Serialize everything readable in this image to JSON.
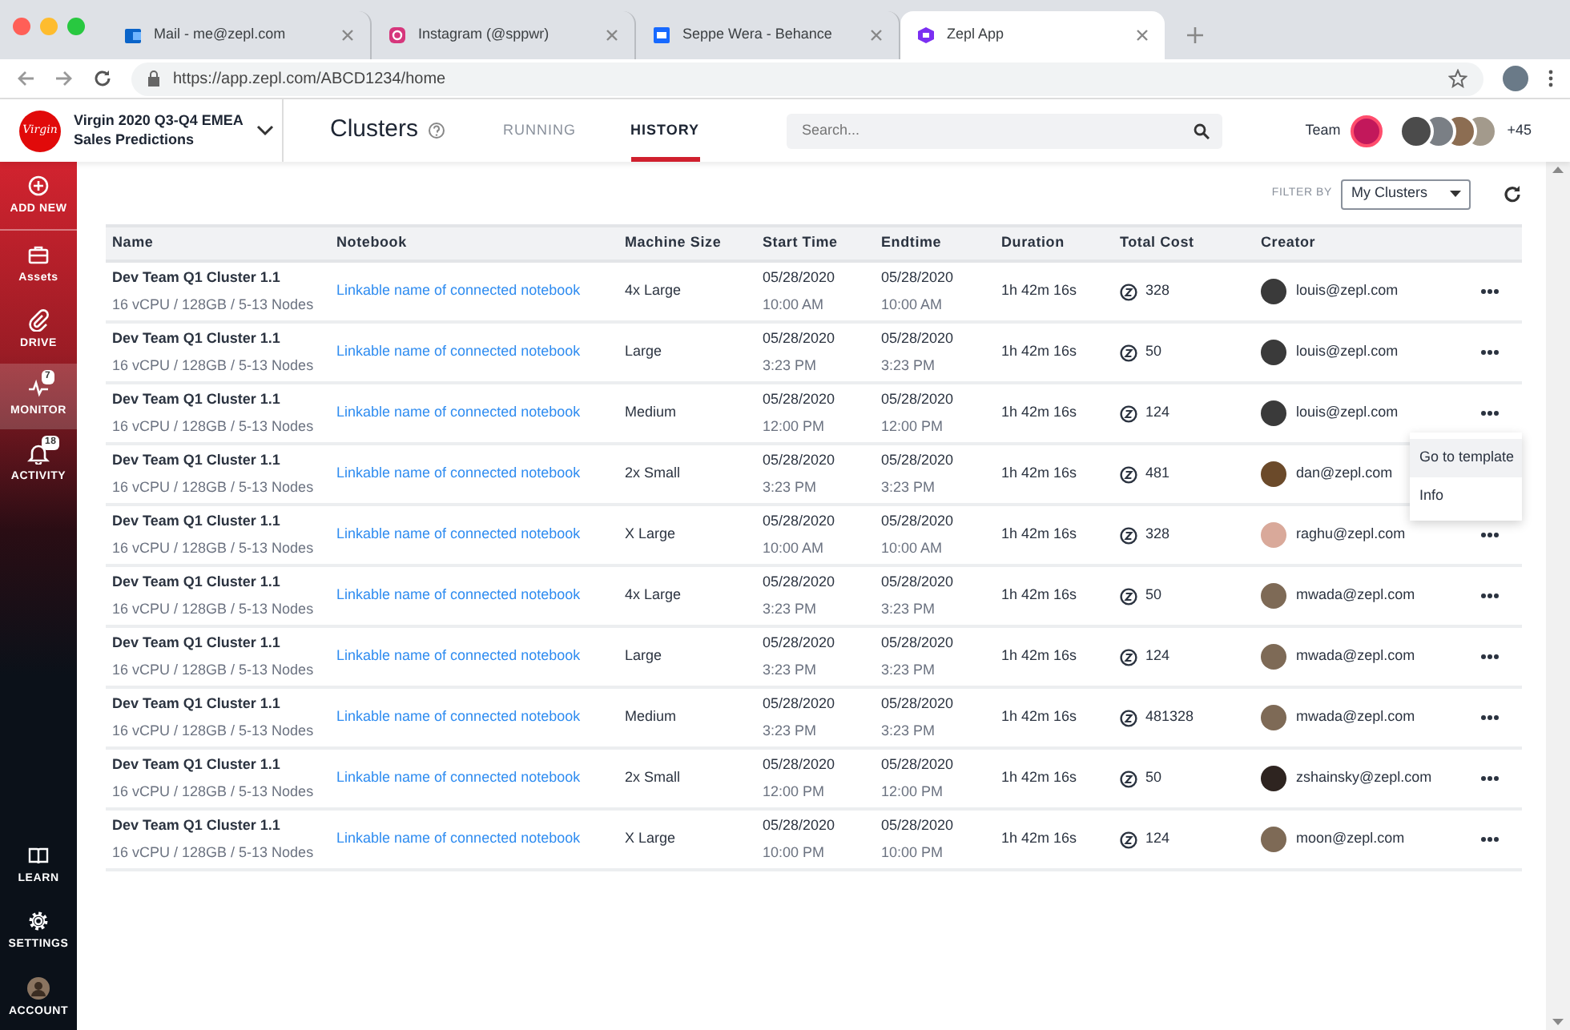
{
  "browser": {
    "tabs": [
      {
        "title": "Mail - me@zepl.com",
        "selected": false
      },
      {
        "title": "Instagram (@sppwr)",
        "selected": false
      },
      {
        "title": "Seppe Wera - Behance",
        "selected": false
      },
      {
        "title": "Zepl App",
        "selected": true
      }
    ],
    "url": "https://app.zepl.com/ABCD1234/home"
  },
  "header": {
    "logo_text": "Virgin",
    "project": [
      "Virgin 2020 Q3-Q4 EMEA",
      "Sales Predictions"
    ],
    "title": "Clusters",
    "tabs": [
      {
        "label": "RUNNING",
        "selected": false
      },
      {
        "label": "HISTORY",
        "selected": true
      }
    ],
    "search": {
      "placeholder": "Search..."
    },
    "team_label": "Team",
    "team_more": "+45"
  },
  "sidebar": {
    "top": [
      {
        "label": "ADD NEW",
        "selected": false
      },
      {
        "label": "Assets",
        "selected": false
      },
      {
        "label": "DRIVE",
        "selected": false
      },
      {
        "label": "MONITOR",
        "selected": true,
        "badge": "7"
      },
      {
        "label": "ACTIVITY",
        "selected": false,
        "badge": "18"
      }
    ],
    "bottom": [
      {
        "label": "LEARN",
        "selected": false
      },
      {
        "label": "SETTINGS",
        "selected": false
      },
      {
        "label": "ACCOUNT",
        "selected": false
      }
    ]
  },
  "filter": {
    "label": "FILTER BY",
    "value": "My Clusters"
  },
  "table": {
    "columns": [
      "Name",
      "Notebook",
      "Machine Size",
      "Start Time",
      "Endtime",
      "Duration",
      "Total Cost",
      "Creator"
    ],
    "rows": [
      {
        "name": "Dev Team Q1 Cluster 1.1",
        "specs": "16 vCPU / 128GB / 5-13 Nodes",
        "notebook": "Linkable name of connected notebook",
        "size": "4x Large",
        "start": [
          "05/28/2020",
          "10:00 AM"
        ],
        "end": [
          "05/28/2020",
          "10:00 AM"
        ],
        "duration": "1h 42m 16s",
        "cost": "328",
        "creator": "louis@zepl.com",
        "menu_open": false
      },
      {
        "name": "Dev Team Q1 Cluster 1.1",
        "specs": "16 vCPU / 128GB / 5-13 Nodes",
        "notebook": "Linkable name of connected notebook",
        "size": "Large",
        "start": [
          "05/28/2020",
          "3:23 PM"
        ],
        "end": [
          "05/28/2020",
          "3:23 PM"
        ],
        "duration": "1h 42m 16s",
        "cost": "50",
        "creator": "louis@zepl.com",
        "menu_open": false
      },
      {
        "name": "Dev Team Q1 Cluster 1.1",
        "specs": "16 vCPU / 128GB / 5-13 Nodes",
        "notebook": "Linkable name of connected notebook",
        "size": "Medium",
        "start": [
          "05/28/2020",
          "12:00 PM"
        ],
        "end": [
          "05/28/2020",
          "12:00 PM"
        ],
        "duration": "1h 42m 16s",
        "cost": "124",
        "creator": "louis@zepl.com",
        "menu_open": true
      },
      {
        "name": "Dev Team Q1 Cluster 1.1",
        "specs": "16 vCPU / 128GB / 5-13 Nodes",
        "notebook": "Linkable name of connected notebook",
        "size": "2x Small",
        "start": [
          "05/28/2020",
          "3:23 PM"
        ],
        "end": [
          "05/28/2020",
          "3:23 PM"
        ],
        "duration": "1h 42m 16s",
        "cost": "481",
        "creator": "dan@zepl.com",
        "menu_open": false
      },
      {
        "name": "Dev Team Q1 Cluster 1.1",
        "specs": "16 vCPU / 128GB / 5-13 Nodes",
        "notebook": "Linkable name of connected notebook",
        "size": "X Large",
        "start": [
          "05/28/2020",
          "10:00 AM"
        ],
        "end": [
          "05/28/2020",
          "10:00 AM"
        ],
        "duration": "1h 42m 16s",
        "cost": "328",
        "creator": "raghu@zepl.com",
        "menu_open": false
      },
      {
        "name": "Dev Team Q1 Cluster 1.1",
        "specs": "16 vCPU / 128GB / 5-13 Nodes",
        "notebook": "Linkable name of connected notebook",
        "size": "4x Large",
        "start": [
          "05/28/2020",
          "3:23 PM"
        ],
        "end": [
          "05/28/2020",
          "3:23 PM"
        ],
        "duration": "1h 42m 16s",
        "cost": "50",
        "creator": "mwada@zepl.com",
        "menu_open": false
      },
      {
        "name": "Dev Team Q1 Cluster 1.1",
        "specs": "16 vCPU / 128GB / 5-13 Nodes",
        "notebook": "Linkable name of connected notebook",
        "size": "Large",
        "start": [
          "05/28/2020",
          "3:23 PM"
        ],
        "end": [
          "05/28/2020",
          "3:23 PM"
        ],
        "duration": "1h 42m 16s",
        "cost": "124",
        "creator": "mwada@zepl.com",
        "menu_open": false
      },
      {
        "name": "Dev Team Q1 Cluster 1.1",
        "specs": "16 vCPU / 128GB / 5-13 Nodes",
        "notebook": "Linkable name of connected notebook",
        "size": "Medium",
        "start": [
          "05/28/2020",
          "3:23 PM"
        ],
        "end": [
          "05/28/2020",
          "3:23 PM"
        ],
        "duration": "1h 42m 16s",
        "cost": "481328",
        "creator": "mwada@zepl.com",
        "menu_open": false
      },
      {
        "name": "Dev Team Q1 Cluster 1.1",
        "specs": "16 vCPU / 128GB / 5-13 Nodes",
        "notebook": "Linkable name of connected notebook",
        "size": "2x Small",
        "start": [
          "05/28/2020",
          "12:00 PM"
        ],
        "end": [
          "05/28/2020",
          "12:00 PM"
        ],
        "duration": "1h 42m 16s",
        "cost": "50",
        "creator": "zshainsky@zepl.com",
        "menu_open": false
      },
      {
        "name": "Dev Team Q1 Cluster 1.1",
        "specs": "16 vCPU / 128GB / 5-13 Nodes",
        "notebook": "Linkable name of connected notebook",
        "size": "X Large",
        "start": [
          "05/28/2020",
          "10:00 PM"
        ],
        "end": [
          "05/28/2020",
          "10:00 PM"
        ],
        "duration": "1h 42m 16s",
        "cost": "124",
        "creator": "moon@zepl.com",
        "menu_open": false
      }
    ]
  },
  "row_menu": [
    {
      "label": "Go to template",
      "selected": true
    },
    {
      "label": "Info",
      "selected": false
    }
  ]
}
